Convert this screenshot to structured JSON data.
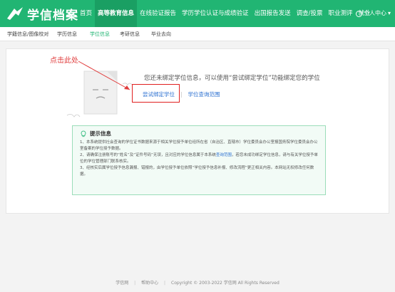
{
  "header": {
    "logo_text": "学信档案",
    "nav": [
      "首页",
      "高等教育信息",
      "在线验证报告",
      "学历学位认证与成绩验证",
      "出国报告发送",
      "调查/投票",
      "职业测评",
      "就业"
    ],
    "active_nav": 1,
    "user_label": "个人中心"
  },
  "subnav": {
    "items": [
      "学籍信息/图像校对",
      "学历信息",
      "学位信息",
      "考研信息",
      "毕业去向"
    ],
    "active": 2
  },
  "annotation": {
    "text": "点击此处"
  },
  "main": {
    "message": "您还未绑定学位信息，可以使用“尝试绑定学位”功能绑定您的学位",
    "bind_link": "尝试绑定学位",
    "query_link": "学位查询范围"
  },
  "tips": {
    "title": "提示信息",
    "items": [
      "1、本系统提供社会查询的学位证书数据来源于相关学位授予单位经所在省（自治区、直辖市）学位委员会办公室报国务院学位委员会办公室备案的学位授予数据。",
      "2、请确保注册账号的“姓名”及“证件号码”无误，且对应的学位信息属于本系统查询范围，若您未成功绑定学位信息，请与有关学位授予单位的学位管理部门联系核实。",
      "3、经核实后属学位授予信息漏报、错报的，由学位授予单位依照“学位授予信息补报、修改流程”更正相关内容。本网站无权修改任何数据。"
    ],
    "highlight_word": "查询范围"
  },
  "footer": {
    "links": [
      "学信网",
      "帮助中心"
    ],
    "copyright": "Copyright © 2003-2022 学信网 All Rights Reserved"
  },
  "colors": {
    "brand": "#21b573",
    "link": "#2a6fd0",
    "annotation": "#e03c3c"
  }
}
